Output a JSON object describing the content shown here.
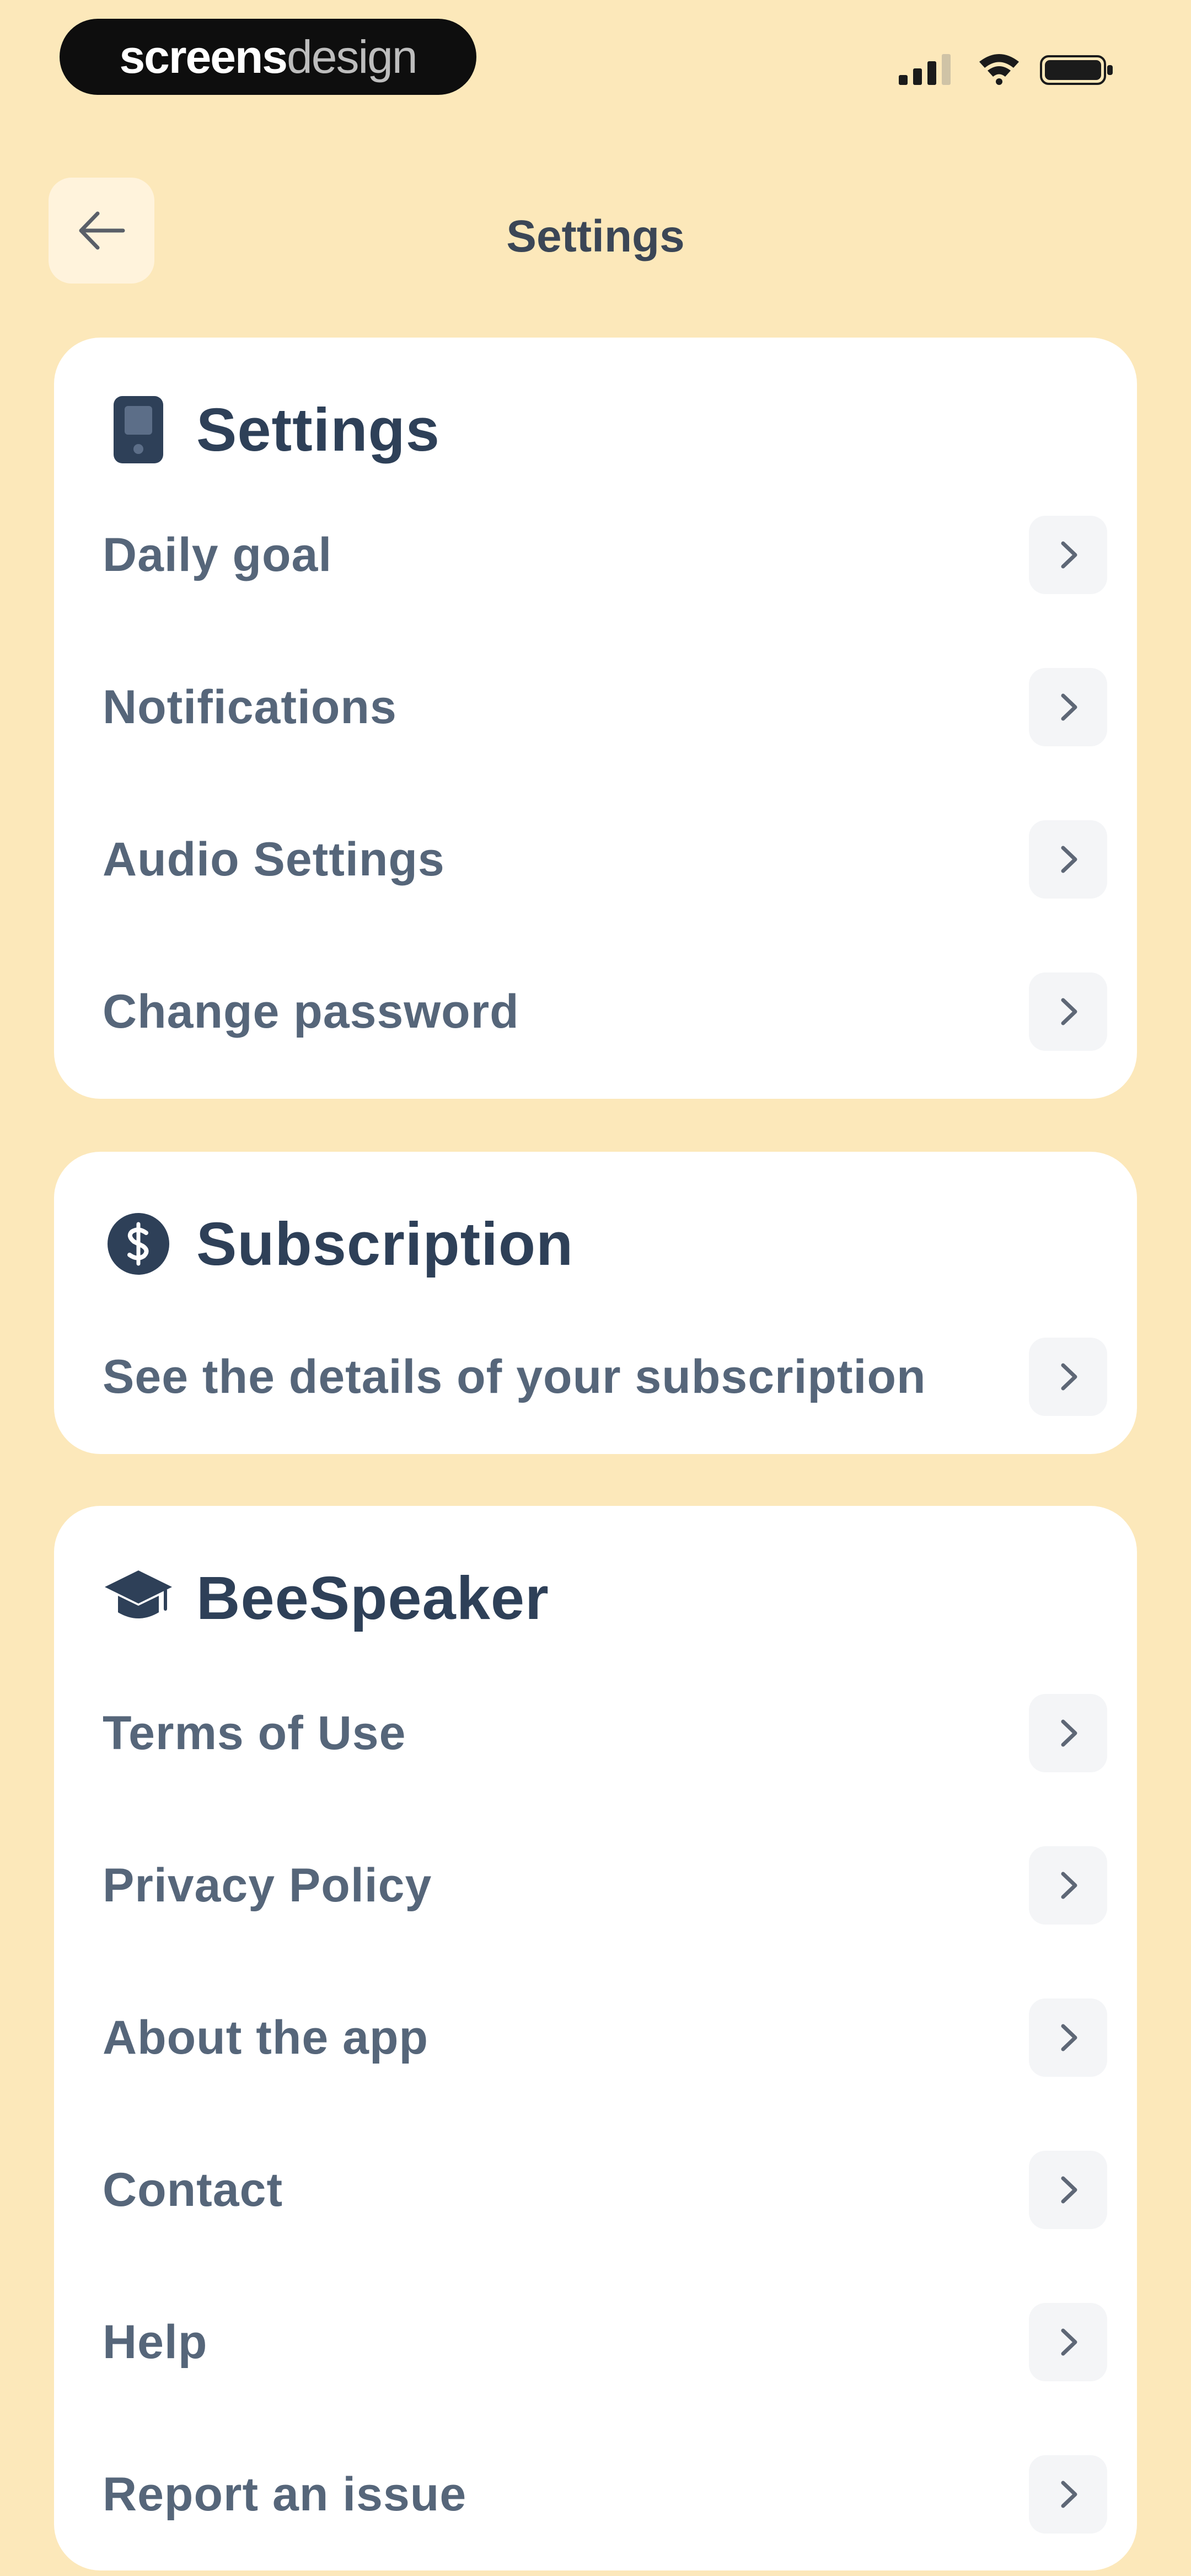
{
  "status_bar": {
    "brand_strong": "screens",
    "brand_light": "design",
    "icons": [
      "signal-icon",
      "wifi-icon",
      "battery-icon"
    ]
  },
  "header": {
    "back_icon": "arrow-left-icon",
    "title": "Settings"
  },
  "sections": {
    "settings": {
      "title": "Settings",
      "icon": "phone-icon",
      "items": [
        {
          "label": "Daily goal"
        },
        {
          "label": "Notifications"
        },
        {
          "label": "Audio Settings"
        },
        {
          "label": "Change password"
        }
      ]
    },
    "subscription": {
      "title": "Subscription",
      "icon": "dollar-coin-icon",
      "items": [
        {
          "label": "See the details of your subscription"
        }
      ]
    },
    "beespeaker": {
      "title": "BeeSpeaker",
      "icon": "graduation-cap-icon",
      "items": [
        {
          "label": "Terms of Use"
        },
        {
          "label": "Privacy Policy"
        },
        {
          "label": "About the app"
        },
        {
          "label": "Contact"
        },
        {
          "label": "Help"
        },
        {
          "label": "Report an issue"
        }
      ]
    }
  },
  "colors": {
    "background": "#FCE8BA",
    "card": "#FFFFFF",
    "title_text": "#2E4058",
    "row_text": "#56667A",
    "chevron_bg": "#F4F5F7"
  }
}
